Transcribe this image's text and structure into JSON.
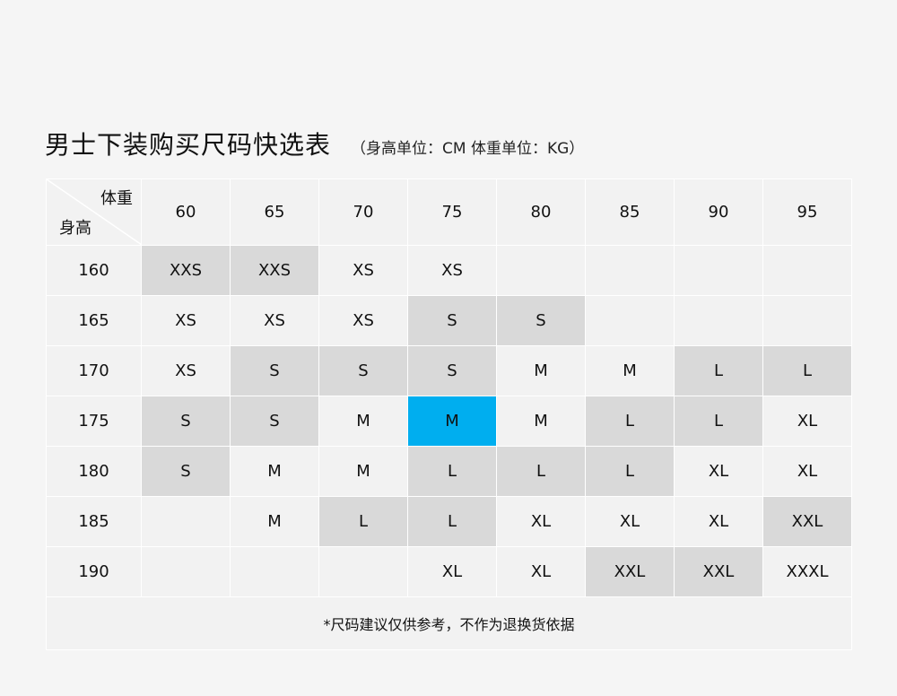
{
  "header": {
    "title": "男士下装购买尺码快选表",
    "subtitle": "（身高单位：CM 体重单位：KG）"
  },
  "table": {
    "corner_weight_label": "体重",
    "corner_height_label": "身高",
    "weights": [
      "60",
      "65",
      "70",
      "75",
      "80",
      "85",
      "90",
      "95"
    ],
    "rows": [
      {
        "height": "160",
        "cells": [
          {
            "size": "XXS",
            "shade": "dark"
          },
          {
            "size": "XXS",
            "shade": "dark"
          },
          {
            "size": "XS",
            "shade": "light"
          },
          {
            "size": "XS",
            "shade": "light"
          },
          {
            "size": "",
            "shade": "light"
          },
          {
            "size": "",
            "shade": "light"
          },
          {
            "size": "",
            "shade": "light"
          },
          {
            "size": "",
            "shade": "light"
          }
        ]
      },
      {
        "height": "165",
        "cells": [
          {
            "size": "XS",
            "shade": "light"
          },
          {
            "size": "XS",
            "shade": "light"
          },
          {
            "size": "XS",
            "shade": "light"
          },
          {
            "size": "S",
            "shade": "dark"
          },
          {
            "size": "S",
            "shade": "dark"
          },
          {
            "size": "",
            "shade": "light"
          },
          {
            "size": "",
            "shade": "light"
          },
          {
            "size": "",
            "shade": "light"
          }
        ]
      },
      {
        "height": "170",
        "cells": [
          {
            "size": "XS",
            "shade": "light"
          },
          {
            "size": "S",
            "shade": "dark"
          },
          {
            "size": "S",
            "shade": "dark"
          },
          {
            "size": "S",
            "shade": "dark"
          },
          {
            "size": "M",
            "shade": "light"
          },
          {
            "size": "M",
            "shade": "light"
          },
          {
            "size": "L",
            "shade": "dark"
          },
          {
            "size": "L",
            "shade": "dark"
          }
        ]
      },
      {
        "height": "175",
        "cells": [
          {
            "size": "S",
            "shade": "dark"
          },
          {
            "size": "S",
            "shade": "dark"
          },
          {
            "size": "M",
            "shade": "light"
          },
          {
            "size": "M",
            "shade": "highlight"
          },
          {
            "size": "M",
            "shade": "light"
          },
          {
            "size": "L",
            "shade": "dark"
          },
          {
            "size": "L",
            "shade": "dark"
          },
          {
            "size": "XL",
            "shade": "light"
          }
        ]
      },
      {
        "height": "180",
        "cells": [
          {
            "size": "S",
            "shade": "dark"
          },
          {
            "size": "M",
            "shade": "light"
          },
          {
            "size": "M",
            "shade": "light"
          },
          {
            "size": "L",
            "shade": "dark"
          },
          {
            "size": "L",
            "shade": "dark"
          },
          {
            "size": "L",
            "shade": "dark"
          },
          {
            "size": "XL",
            "shade": "light"
          },
          {
            "size": "XL",
            "shade": "light"
          }
        ]
      },
      {
        "height": "185",
        "cells": [
          {
            "size": "",
            "shade": "light"
          },
          {
            "size": "M",
            "shade": "light"
          },
          {
            "size": "L",
            "shade": "dark"
          },
          {
            "size": "L",
            "shade": "dark"
          },
          {
            "size": "XL",
            "shade": "light"
          },
          {
            "size": "XL",
            "shade": "light"
          },
          {
            "size": "XL",
            "shade": "light"
          },
          {
            "size": "XXL",
            "shade": "dark"
          }
        ]
      },
      {
        "height": "190",
        "cells": [
          {
            "size": "",
            "shade": "light"
          },
          {
            "size": "",
            "shade": "light"
          },
          {
            "size": "",
            "shade": "light"
          },
          {
            "size": "XL",
            "shade": "light"
          },
          {
            "size": "XL",
            "shade": "light"
          },
          {
            "size": "XXL",
            "shade": "dark"
          },
          {
            "size": "XXL",
            "shade": "dark"
          },
          {
            "size": "XXXL",
            "shade": "light"
          }
        ]
      }
    ],
    "note": "*尺码建议仅供参考，不作为退换货依据"
  },
  "colors": {
    "light": "#f2f2f2",
    "dark": "#d9d9d9",
    "highlight": "#00aeef",
    "background": "#f5f5f5"
  }
}
